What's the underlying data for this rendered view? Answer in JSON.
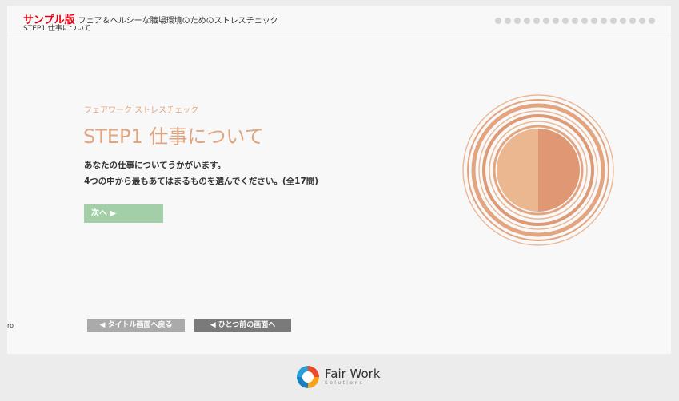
{
  "header": {
    "sample_label": "サンプル版",
    "subtitle": "フェア＆ヘルシーな職場環境のためのストレスチェック",
    "breadcrumb": "STEP1 仕事について"
  },
  "progress": {
    "total_steps": 17,
    "current_step": 0
  },
  "main": {
    "kicker": "フェアワーク ストレスチェック",
    "title": "STEP1 仕事について",
    "desc_line1": "あなたの仕事についてうかがいます。",
    "desc_line2": "4つの中から最もあてはまるものを選んでください。(全17問)",
    "next_label": "次へ ▶"
  },
  "nav": {
    "back_to_title": "◀ タイトル画面へ戻る",
    "prev_screen": "◀ ひとつ前の画面へ",
    "stray_mark": "ro"
  },
  "footer": {
    "logo_main": "Fair Work",
    "logo_sub": "Solutions"
  },
  "colors": {
    "accent": "#e0a47e",
    "accent_dark": "#dc9470",
    "next_button": "#a2cfa8",
    "sample_red": "#e60012"
  }
}
